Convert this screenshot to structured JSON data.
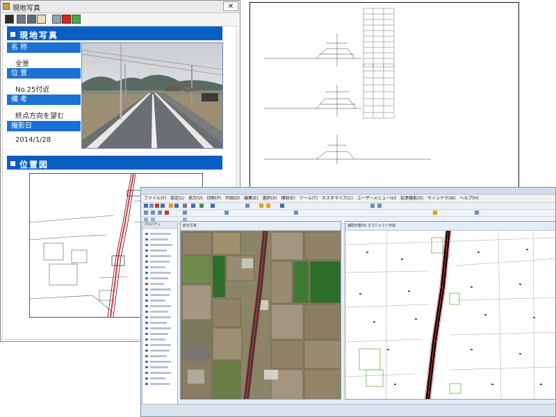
{
  "photo_window": {
    "title": "現地写真",
    "close_label": "✕",
    "toolbar": [
      "save-icon",
      "print-icon",
      "print-preview-icon",
      "zoom-icon",
      "layout-icon",
      "export-icon",
      "document-icon"
    ],
    "photo_section": {
      "header": "現地写真",
      "fields": [
        {
          "label": "名 称",
          "value": "全景"
        },
        {
          "label": "位 置",
          "value": "No.25付近"
        },
        {
          "label": "備 考",
          "value": "終点方向を望む"
        },
        {
          "label": "撮影日",
          "value": "2014/1/28"
        }
      ]
    },
    "location_section": {
      "header": "位置図"
    }
  },
  "cad_window": {
    "menu": [
      "ファイル(F)",
      "設定(L)",
      "表示(V)",
      "印刷(P)",
      "作図(D)",
      "編集(E)",
      "選択(X)",
      "補助(E)",
      "ツール(T)",
      "カスタマイズ(C)",
      "ユーザーメニュー(U)",
      "拡張機能(X)",
      "ウィンドウ(W)",
      "ヘルプ(H)"
    ],
    "side_panel_title": "プロパティ",
    "aerial_tab": "航空写真",
    "vector_tab": "補助作業(R) オブジェクト作成"
  },
  "colors": {
    "section_blue": "#0a5fc5",
    "label_blue": "#1b72d3",
    "road_red": "#e0303a"
  }
}
